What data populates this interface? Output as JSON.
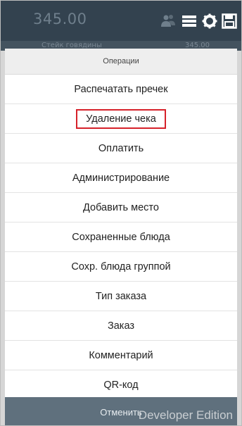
{
  "topbar": {
    "total": "345.00",
    "icons": [
      "users-icon",
      "menu-lines-icon",
      "gear-icon",
      "save-icon"
    ]
  },
  "underrow": {
    "left_text": "Стейк говядины",
    "right_text": "345.00"
  },
  "menu": {
    "title": "Операции",
    "items": [
      {
        "label": "Распечатать пречек"
      },
      {
        "label": "Удаление чека",
        "highlighted": true
      },
      {
        "label": "Оплатить"
      },
      {
        "label": "Администрирование"
      },
      {
        "label": "Добавить место"
      },
      {
        "label": "Сохраненные блюда"
      },
      {
        "label": "Сохр. блюда группой"
      },
      {
        "label": "Тип заказа"
      },
      {
        "label": "Заказ"
      },
      {
        "label": "Комментарий"
      },
      {
        "label": "QR-код"
      }
    ],
    "cancel_label": "Отменить"
  },
  "watermark": "Developer Edition",
  "colors": {
    "topbar": "#33424f",
    "cancel_bar": "#5f707d",
    "highlight_border": "#d6212a"
  }
}
